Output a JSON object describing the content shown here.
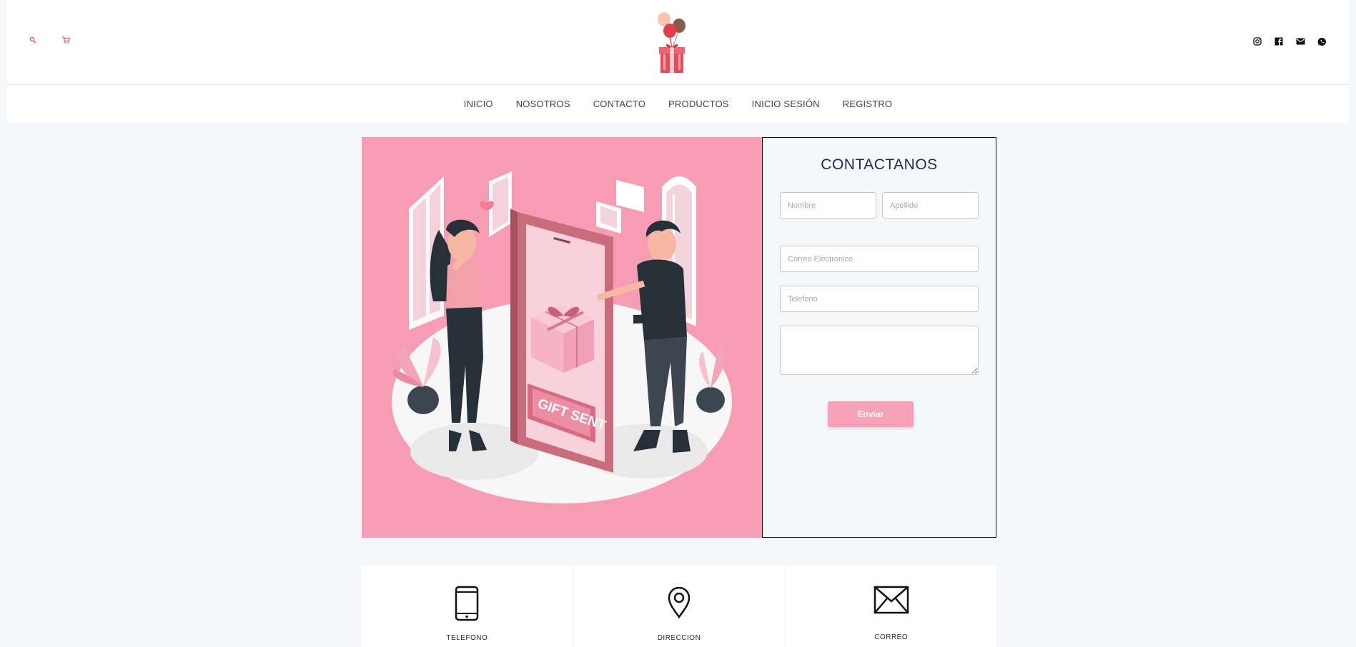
{
  "header": {
    "icons": [
      "search-icon",
      "cart-icon"
    ],
    "social_icons": [
      "instagram-icon",
      "facebook-icon",
      "mail-icon",
      "whatsapp-icon"
    ],
    "accent": "#e05a7a"
  },
  "nav": {
    "items": [
      {
        "label": "INICIO"
      },
      {
        "label": "NOSOTROS"
      },
      {
        "label": "CONTACTO"
      },
      {
        "label": "PRODUCTOS"
      },
      {
        "label": "INICIO SESIÓN"
      },
      {
        "label": "REGISTRO"
      }
    ]
  },
  "illustration": {
    "sign_text": "GIFT SENT",
    "background": "#f79db3"
  },
  "contact_form": {
    "title": "CONTACTANOS",
    "nombre_placeholder": "Nombre",
    "apellido_placeholder": "Apellido",
    "email_placeholder": "Correo Electronico",
    "telefono_placeholder": "Telefono",
    "mensaje_placeholder": "",
    "submit_label": "Enviar",
    "button_color": "#f7a1b6"
  },
  "info_cards": [
    {
      "label": "TELEFONO",
      "icon": "phone-icon"
    },
    {
      "label": "DIRECCION",
      "icon": "location-pin-icon"
    },
    {
      "label": "CORREO",
      "icon": "envelope-icon"
    }
  ]
}
